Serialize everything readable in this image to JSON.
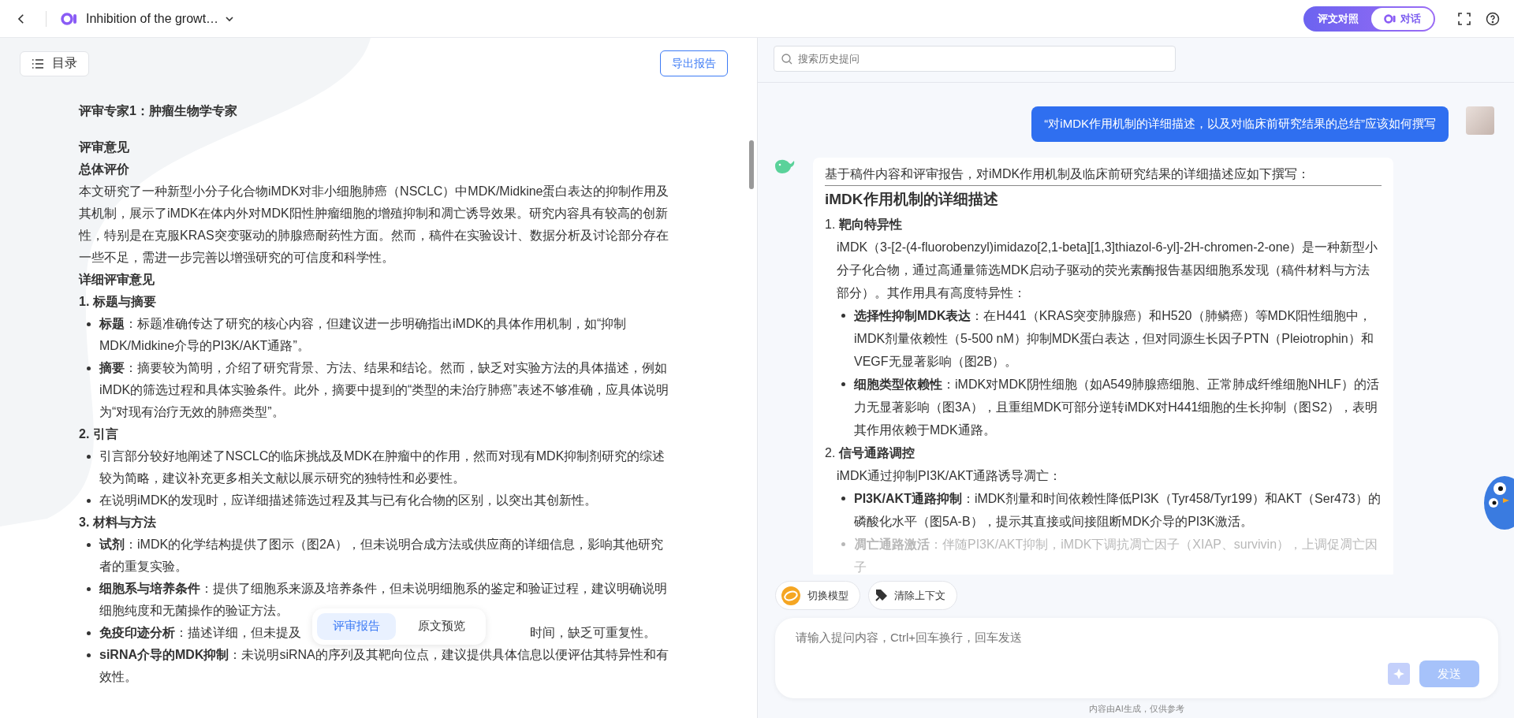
{
  "top_bar": {
    "title": "Inhibition of the growt…",
    "mode_tabs": [
      {
        "label": "评文对照",
        "selected": false
      },
      {
        "label": "对话",
        "selected": true
      }
    ]
  },
  "report": {
    "toc_button": "目录",
    "export_button": "导出报告",
    "blocks": [
      {
        "kind": "heading",
        "text": "评审专家1：肿瘤生物学专家"
      },
      {
        "kind": "section",
        "text": "评审意见"
      },
      {
        "kind": "subheading",
        "text": "总体评价"
      },
      {
        "kind": "para",
        "text": "本文研究了一种新型小分子化合物iMDK对非小细胞肺癌（NSCLC）中MDK/Midkine蛋白表达的抑制作用及其机制，展示了iMDK在体内外对MDK阳性肿瘤细胞的增殖抑制和凋亡诱导效果。研究内容具有较高的创新性，特别是在克服KRAS突变驱动的肺腺癌耐药性方面。然而，稿件在实验设计、数据分析及讨论部分存在一些不足，需进一步完善以增强研究的可信度和科学性。"
      },
      {
        "kind": "subheading",
        "text": "详细评审意见"
      },
      {
        "kind": "subheading",
        "text": "1. 标题与摘要"
      },
      {
        "kind": "bullet",
        "text": "**标题**：标题准确传达了研究的核心内容，但建议进一步明确指出iMDK的具体作用机制，如“抑制MDK/Midkine介导的PI3K/AKT通路”。"
      },
      {
        "kind": "bullet",
        "text": "**摘要**：摘要较为简明，介绍了研究背景、方法、结果和结论。然而，缺乏对实验方法的具体描述，例如iMDK的筛选过程和具体实验条件。此外，摘要中提到的“类型的未治疗肺癌”表述不够准确，应具体说明为“对现有治疗无效的肺癌类型”。"
      },
      {
        "kind": "subheading",
        "text": "2. 引言"
      },
      {
        "kind": "bullet",
        "text": "引言部分较好地阐述了NSCLC的临床挑战及MDK在肿瘤中的作用，然而对现有MDK抑制剂研究的综述较为简略，建议补充更多相关文献以展示研究的独特性和必要性。"
      },
      {
        "kind": "bullet",
        "text": "在说明iMDK的发现时，应详细描述筛选过程及其与已有化合物的区别，以突出其创新性。"
      },
      {
        "kind": "subheading",
        "text": "3. 材料与方法"
      },
      {
        "kind": "bullet",
        "text": "**试剂**：iMDK的化学结构提供了图示（图2A），但未说明合成方法或供应商的详细信息，影响其他研究者的重复实验。"
      },
      {
        "kind": "bullet",
        "text": "**细胞系与培养条件**：提供了细胞系来源及培养条件，但未说明细胞系的鉴定和验证过程，建议明确说明细胞纯度和无菌操作的验证方法。"
      },
      {
        "kind": "covered_bullet",
        "text": "**免疫印迹分析**：描述详细，但未提及",
        "text_after": "时间，缺乏可重复性。"
      },
      {
        "kind": "bullet",
        "text": "**siRNA介导的MDK抑制**：未说明siRNA的序列及其靶向位点，建议提供具体信息以便评估其特异性和有效性。"
      }
    ],
    "view_tabs": [
      {
        "label": "评审报告",
        "selected": true
      },
      {
        "label": "原文预览",
        "selected": false
      }
    ]
  },
  "chat": {
    "search": {
      "placeholder": "搜索历史提问"
    },
    "user_message": "“对iMDK作用机制的详细描述，以及对临床前研究结果的总结”应该如何撰写",
    "answer": {
      "intro": "基于稿件内容和评审报告，对iMDK作用机制及临床前研究结果的详细描述应如下撰写：",
      "heading": "iMDK作用机制的详细描述",
      "sections": [
        {
          "number": "1.",
          "title": "靶向特异性",
          "text": "iMDK（3-[2-(4-fluorobenzyl)imidazo[2,1-beta][1,3]thiazol-6-yl]-2H-chromen-2-one）是一种新型小分子化合物，通过高通量筛选MDK启动子驱动的荧光素酶报告基因细胞系发现（稿件材料与方法部分）。其作用具有高度特异性：",
          "bullets": [
            {
              "text": "**选择性抑制MDK表达**：在H441（KRAS突变肺腺癌）和H520（肺鳞癌）等MDK阳性细胞中，iMDK剂量依赖性（5-500 nM）抑制MDK蛋白表达，但对同源生长因子PTN（Pleiotrophin）和VEGF无显著影响（图2B）。",
              "faded": false
            },
            {
              "text": "**细胞类型依赖性**：iMDK对MDK阴性细胞（如A549肺腺癌细胞、正常肺成纤维细胞NHLF）的活力无显著影响（图3A），且重组MDK可部分逆转iMDK对H441细胞的生长抑制（图S2），表明其作用依赖于MDK通路。",
              "faded": false
            }
          ]
        },
        {
          "number": "2.",
          "title": "信号通路调控",
          "text": "iMDK通过抑制PI3K/AKT通路诱导凋亡：",
          "bullets": [
            {
              "text": "**PI3K/AKT通路抑制**：iMDK剂量和时间依赖性降低PI3K（Tyr458/Tyr199）和AKT（Ser473）的磷酸化水平（图5A-B），提示其直接或间接阻断MDK介导的PI3K激活。",
              "faded": false
            },
            {
              "text": "**凋亡通路激活**：伴随PI3K/AKT抑制，iMDK下调抗凋亡因子（XIAP、survivin），上调促凋亡因子",
              "faded": true
            }
          ]
        }
      ]
    },
    "chips": [
      "切换模型",
      "清除上下文"
    ],
    "composer": {
      "placeholder": "请输入提问内容，Ctrl+回车换行，回车发送",
      "send_button": "发送",
      "send_disabled": true
    },
    "footnote": "内容由AI生成，仅供参考"
  }
}
